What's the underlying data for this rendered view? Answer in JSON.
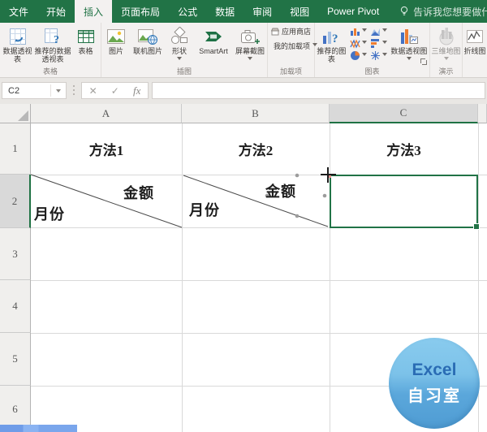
{
  "menubar": {
    "tabs": [
      {
        "label": "文件"
      },
      {
        "label": "开始"
      },
      {
        "label": "插入"
      },
      {
        "label": "页面布局"
      },
      {
        "label": "公式"
      },
      {
        "label": "数据"
      },
      {
        "label": "审阅"
      },
      {
        "label": "视图"
      },
      {
        "label": "Power Pivot"
      }
    ],
    "selected_tab": "插入",
    "tell_me": "告诉我您想要做什么..."
  },
  "ribbon": {
    "groups": [
      {
        "label": "表格",
        "buttons": [
          {
            "label": "数据透视表"
          },
          {
            "label": "推荐的数据透视表"
          },
          {
            "label": "表格"
          }
        ]
      },
      {
        "label": "插图",
        "buttons": [
          {
            "label": "图片"
          },
          {
            "label": "联机图片"
          },
          {
            "label": "形状"
          },
          {
            "label": "SmartArt"
          },
          {
            "label": "屏幕截图"
          }
        ]
      },
      {
        "label": "加载项",
        "buttons": [
          {
            "label": "应用商店"
          },
          {
            "label": "我的加载项"
          }
        ]
      },
      {
        "label": "图表",
        "buttons": [
          {
            "label": "推荐的图表"
          },
          {
            "label": "数据透视图"
          }
        ]
      },
      {
        "label": "演示",
        "buttons": [
          {
            "label": "三维地图"
          }
        ]
      },
      {
        "label": "",
        "buttons": [
          {
            "label": "折线图"
          }
        ]
      }
    ]
  },
  "formula_bar": {
    "name_box": "C2",
    "cancel": "✕",
    "enter": "✓",
    "insert_function": "fx",
    "formula": ""
  },
  "sheet": {
    "columns": [
      "A",
      "B",
      "C"
    ],
    "rows": [
      "1",
      "2",
      "3",
      "4",
      "5",
      "6"
    ],
    "cells": {
      "a1": "方法1",
      "b1": "方法2",
      "c1": "方法3",
      "a2_amount": "金额",
      "a2_month": "月份",
      "b2_amount": "金额",
      "b2_month": "月份"
    },
    "selected_cell": "C2"
  },
  "watermark": {
    "line1": "Excel",
    "line2": "自习室"
  },
  "colors": {
    "excel_green": "#217346",
    "selection_green": "#1f7244",
    "watermark_blue": "#5aa6da"
  }
}
